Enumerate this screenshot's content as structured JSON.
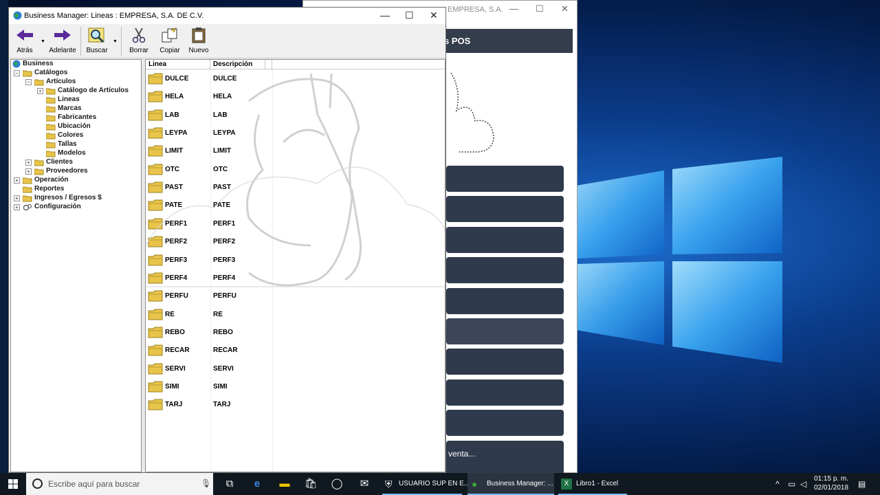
{
  "window": {
    "title": "Business Manager: Lineas : EMPRESA, S.A. DE C.V.",
    "minimize": "—",
    "maximize": "☐",
    "close": "✕"
  },
  "toolbar": {
    "back_label": "Atrás",
    "forward_label": "Adelante",
    "search_label": "Buscar",
    "delete_label": "Borrar",
    "copy_label": "Copiar",
    "new_label": "Nuevo"
  },
  "tree": {
    "root": "Business",
    "catalogos": "Catálogos",
    "articulos": "Artículos",
    "catalogo_articulos": "Catálogo de Artículos",
    "lineas": "Lineas",
    "marcas": "Marcas",
    "fabricantes": "Fabricantes",
    "ubicacion": "Ubicación",
    "colores": "Colores",
    "tallas": "Tallas",
    "modelos": "Modelos",
    "clientes": "Clientes",
    "proveedores": "Proveedores",
    "operacion": "Operación",
    "reportes": "Reportes",
    "ingresos": "Ingresos / Egresos $",
    "configuracion": "Configuración"
  },
  "list": {
    "col_linea": "Linea",
    "col_descripcion": "Descripción",
    "rows": [
      {
        "linea": "DULCE",
        "descripcion": "DULCE"
      },
      {
        "linea": "HELA",
        "descripcion": "HELA"
      },
      {
        "linea": "LAB",
        "descripcion": "LAB"
      },
      {
        "linea": "LEYPA",
        "descripcion": "LEYPA"
      },
      {
        "linea": "LIMIT",
        "descripcion": "LIMIT"
      },
      {
        "linea": "OTC",
        "descripcion": "OTC"
      },
      {
        "linea": "PAST",
        "descripcion": "PAST"
      },
      {
        "linea": "PATE",
        "descripcion": "PATE"
      },
      {
        "linea": "PERF1",
        "descripcion": "PERF1"
      },
      {
        "linea": "PERF2",
        "descripcion": "PERF2"
      },
      {
        "linea": "PERF3",
        "descripcion": "PERF3"
      },
      {
        "linea": "PERF4",
        "descripcion": "PERF4"
      },
      {
        "linea": "PERFU",
        "descripcion": "PERFU"
      },
      {
        "linea": "RE",
        "descripcion": "RE"
      },
      {
        "linea": "REBO",
        "descripcion": "REBO"
      },
      {
        "linea": "RECAR",
        "descripcion": "RECAR"
      },
      {
        "linea": "SERVI",
        "descripcion": "SERVI"
      },
      {
        "linea": "SIMI",
        "descripcion": "SIMI"
      },
      {
        "linea": "TARJ",
        "descripcion": "TARJ"
      }
    ]
  },
  "pos_window": {
    "title": "EMPRESA, S.A.",
    "header": "s POS",
    "last_button": "venta..."
  },
  "taskbar": {
    "search_placeholder": "Escribe aquí para buscar",
    "app1": "USUARIO SUP EN E...",
    "app2": "Business Manager: ...",
    "app3": "Libro1 - Excel",
    "time": "01:15 p. m.",
    "date": "02/01/2018"
  },
  "colors": {
    "folder": "#e8c44a",
    "pos_dark": "#2f3a4c",
    "taskbar": "#101820"
  }
}
